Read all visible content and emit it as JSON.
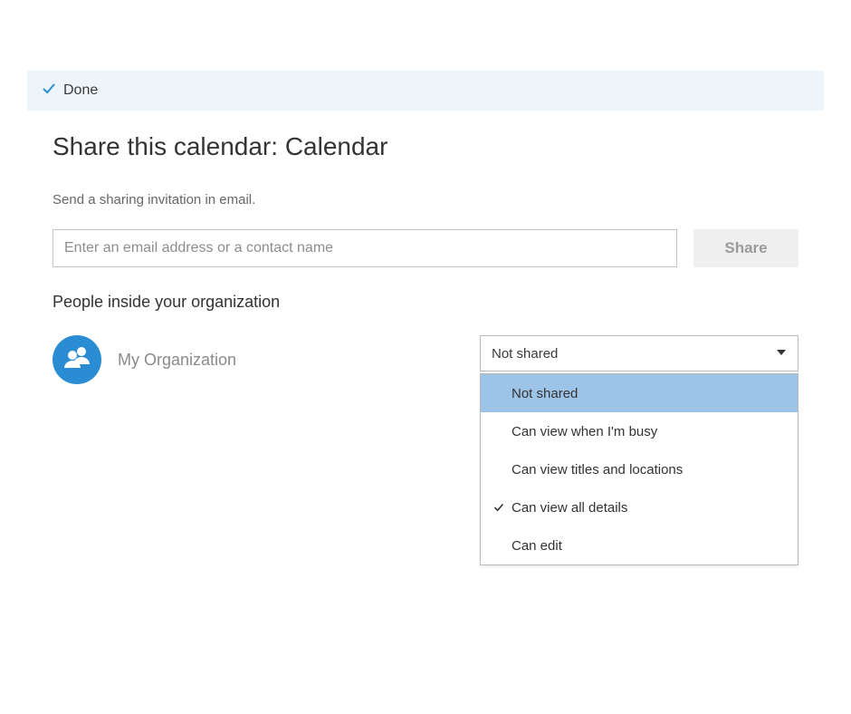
{
  "colors": {
    "accent": "#2a8dd4",
    "highlight": "#9dc3e6",
    "toolbarBg": "#eef5fa"
  },
  "toolbar": {
    "done_label": "Done"
  },
  "page_title": "Share this calendar: Calendar",
  "subtext": "Send a sharing invitation in email.",
  "share": {
    "placeholder": "Enter an email address or a contact name",
    "button_label": "Share"
  },
  "section_title": "People inside your organization",
  "org": {
    "name": "My Organization",
    "icon": "people-icon"
  },
  "permission": {
    "selected": "Not shared",
    "options": [
      {
        "label": "Not shared",
        "highlighted": true,
        "checked": false
      },
      {
        "label": "Can view when I'm busy",
        "highlighted": false,
        "checked": false
      },
      {
        "label": "Can view titles and locations",
        "highlighted": false,
        "checked": false
      },
      {
        "label": "Can view all details",
        "highlighted": false,
        "checked": true
      },
      {
        "label": "Can edit",
        "highlighted": false,
        "checked": false
      }
    ]
  }
}
